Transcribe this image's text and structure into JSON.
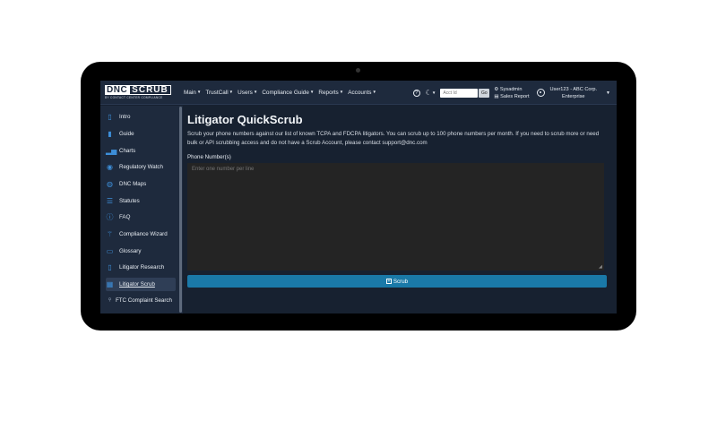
{
  "header": {
    "logo_dnc": "DNC",
    "logo_scrub": "SCRUB",
    "logo_sub": "BY CONTACT CENTER COMPLIANCE",
    "nav": [
      {
        "label": "Main"
      },
      {
        "label": "TrustCall"
      },
      {
        "label": "Users"
      },
      {
        "label": "Compliance Guide"
      },
      {
        "label": "Reports"
      },
      {
        "label": "Accounts"
      }
    ],
    "help_icon": "?",
    "theme_icon": "moon-icon",
    "acct_placeholder": "Acct Id",
    "go_label": "Go",
    "sysadmin_label": "Sysadmin",
    "sales_report_label": "Sales Report",
    "user_name": "User123 - ABC Corp.",
    "user_plan": "Enterprise"
  },
  "sidebar": {
    "items": [
      {
        "label": "Intro",
        "icon": "document-icon"
      },
      {
        "label": "Guide",
        "icon": "book-icon"
      },
      {
        "label": "Charts",
        "icon": "bar-chart-icon"
      },
      {
        "label": "Regulatory Watch",
        "icon": "eye-icon"
      },
      {
        "label": "DNC Maps",
        "icon": "globe-icon"
      },
      {
        "label": "Statutes",
        "icon": "list-icon"
      },
      {
        "label": "FAQ",
        "icon": "question-icon"
      },
      {
        "label": "Compliance Wizard",
        "icon": "wand-icon"
      },
      {
        "label": "Glossary",
        "icon": "open-book-icon"
      },
      {
        "label": "Litigator Research",
        "icon": "clipboard-icon"
      },
      {
        "label": "Litigator Scrub",
        "icon": "table-icon",
        "active": true
      },
      {
        "label": "FTC Complaint Search",
        "icon": "search-icon"
      }
    ]
  },
  "main": {
    "title": "Litigator QuickScrub",
    "description": "Scrub your phone numbers against our list of known TCPA and FDCPA litigators. You can scrub up to 100 phone numbers per month. If you need to scrub more or need bulk or API scrubbing access and do not have a Scrub Account, please contact support@dnc.com",
    "phone_label": "Phone Number(s)",
    "phone_placeholder": "Enter one number per line",
    "scrub_label": "Scrub"
  },
  "colors": {
    "header_bg": "#1e2a3d",
    "page_bg": "#172130",
    "accent_icon": "#3d8ed8",
    "button_bg": "#1a79a8",
    "textarea_bg": "#242424"
  }
}
